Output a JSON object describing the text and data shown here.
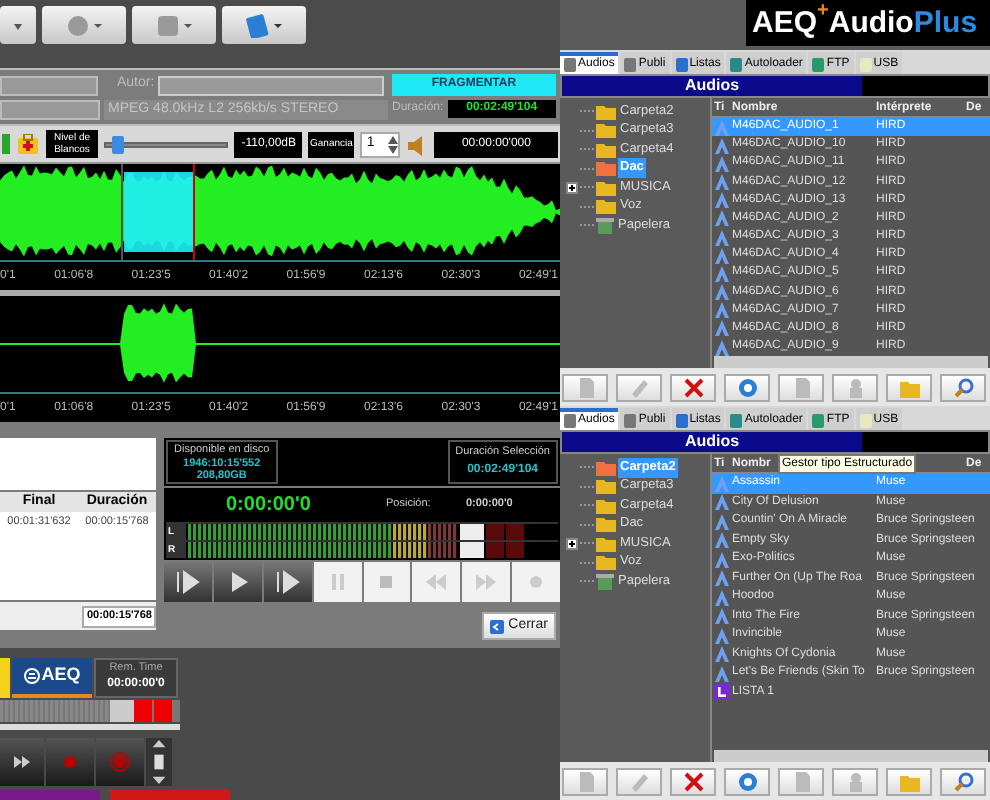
{
  "editor": {
    "author_label": "Autor:",
    "fragment_button": "FRAGMENTAR",
    "format": "MPEG  48.0kHz L2 256kb/s STEREO",
    "duration_label": "Duración:",
    "duration": "00:02:49'104",
    "blank_level_label": "Nivel de Blancos",
    "blank_slider": {
      "level": 0.06
    },
    "blank_db": "-110,00dB",
    "gain_label": "Ganancia",
    "gain": "1",
    "position": "00:00:00'000",
    "timeline_top": [
      "0'1",
      "01:06'8",
      "01:23'5",
      "01:40'2",
      "01:56'9",
      "02:13'6",
      "02:30'3",
      "02:49'1"
    ],
    "timeline_bottom": [
      "0'1",
      "01:06'8",
      "01:23'5",
      "01:40'2",
      "01:56'9",
      "02:13'6",
      "02:30'3",
      "02:49'1"
    ]
  },
  "segments": {
    "columns": [
      "Final",
      "Duración"
    ],
    "rows": [
      [
        "00:01:31'632",
        "00:00:15'768"
      ]
    ],
    "total": "00:00:15'768"
  },
  "player": {
    "disk_label": "Disponible en disco",
    "disk_time": "1946:10:15'552",
    "disk_size": "208,80GB",
    "selection_label": "Duración Selección",
    "selection_duration": "00:02:49'104",
    "time": "0:00:00'0",
    "position_label": "Posición:",
    "position": "0:00:00'0",
    "meters": [
      {
        "label": "L"
      },
      {
        "label": "R"
      }
    ],
    "close_button": "Cerrar"
  },
  "recorder": {
    "logo": "AEQ",
    "rem_time_label": "Rem. Time",
    "rem_time": "00:00:00'0"
  },
  "brand": {
    "prefix": "AEQ",
    "sup": "+",
    "name": "Audio",
    "accent": "Plus"
  },
  "browsers": [
    {
      "tabs": [
        {
          "label": "Audios",
          "selected": true
        },
        {
          "label": "Publi",
          "selected": false
        },
        {
          "label": "Listas",
          "selected": false
        },
        {
          "label": "Autoloader",
          "selected": false
        },
        {
          "label": "FTP",
          "selected": false
        },
        {
          "label": "USB",
          "selected": false
        }
      ],
      "header": "Audios",
      "tree": [
        {
          "kind": "folder",
          "label": "Carpeta2",
          "selected": false
        },
        {
          "kind": "folder",
          "label": "Carpeta3",
          "selected": false
        },
        {
          "kind": "folder",
          "label": "Carpeta4",
          "selected": false
        },
        {
          "kind": "folder",
          "label": "Dac",
          "selected": true
        },
        {
          "kind": "folder",
          "label": "MUSICA",
          "selected": false,
          "expanded": false
        },
        {
          "kind": "folder",
          "label": "Voz",
          "selected": false
        },
        {
          "kind": "trash",
          "label": "Papelera",
          "selected": false
        }
      ],
      "columns": [
        "Ti",
        "Nombre",
        "Intérprete",
        "De"
      ],
      "rows": [
        {
          "kind": "audio",
          "name": "M46DAC_AUDIO_1",
          "artist": "HIRD",
          "selected": true
        },
        {
          "kind": "audio",
          "name": "M46DAC_AUDIO_10",
          "artist": "HIRD",
          "selected": false
        },
        {
          "kind": "audio",
          "name": "M46DAC_AUDIO_11",
          "artist": "HIRD",
          "selected": false
        },
        {
          "kind": "audio",
          "name": "M46DAC_AUDIO_12",
          "artist": "HIRD",
          "selected": false
        },
        {
          "kind": "audio",
          "name": "M46DAC_AUDIO_13",
          "artist": "HIRD",
          "selected": false
        },
        {
          "kind": "audio",
          "name": "M46DAC_AUDIO_2",
          "artist": "HIRD",
          "selected": false
        },
        {
          "kind": "audio",
          "name": "M46DAC_AUDIO_3",
          "artist": "HIRD",
          "selected": false
        },
        {
          "kind": "audio",
          "name": "M46DAC_AUDIO_4",
          "artist": "HIRD",
          "selected": false
        },
        {
          "kind": "audio",
          "name": "M46DAC_AUDIO_5",
          "artist": "HIRD",
          "selected": false
        },
        {
          "kind": "audio",
          "name": "M46DAC_AUDIO_6",
          "artist": "HIRD",
          "selected": false
        },
        {
          "kind": "audio",
          "name": "M46DAC_AUDIO_7",
          "artist": "HIRD",
          "selected": false
        },
        {
          "kind": "audio",
          "name": "M46DAC_AUDIO_8",
          "artist": "HIRD",
          "selected": false
        },
        {
          "kind": "audio",
          "name": "M46DAC_AUDIO_9",
          "artist": "HIRD",
          "selected": false
        }
      ]
    },
    {
      "tabs": [
        {
          "label": "Audios",
          "selected": true
        },
        {
          "label": "Publi",
          "selected": false
        },
        {
          "label": "Listas",
          "selected": false
        },
        {
          "label": "Autoloader",
          "selected": false
        },
        {
          "label": "FTP",
          "selected": false
        },
        {
          "label": "USB",
          "selected": false
        }
      ],
      "header": "Audios",
      "tooltip": "Gestor tipo Estructurado",
      "tree": [
        {
          "kind": "folder",
          "label": "Carpeta2",
          "selected": true
        },
        {
          "kind": "folder",
          "label": "Carpeta3",
          "selected": false
        },
        {
          "kind": "folder",
          "label": "Carpeta4",
          "selected": false
        },
        {
          "kind": "folder",
          "label": "Dac",
          "selected": false
        },
        {
          "kind": "folder",
          "label": "MUSICA",
          "selected": false,
          "expanded": false
        },
        {
          "kind": "folder",
          "label": "Voz",
          "selected": false
        },
        {
          "kind": "trash",
          "label": "Papelera",
          "selected": false
        }
      ],
      "columns": [
        "Ti",
        "Nombr",
        "",
        "De"
      ],
      "rows": [
        {
          "kind": "audio",
          "name": "Assassin",
          "artist": "Muse",
          "selected": true
        },
        {
          "kind": "audio",
          "name": "City Of Delusion",
          "artist": "Muse",
          "selected": false
        },
        {
          "kind": "audio",
          "name": "Countin' On A Miracle",
          "artist": "Bruce Springsteen",
          "selected": false
        },
        {
          "kind": "audio",
          "name": "Empty Sky",
          "artist": "Bruce Springsteen",
          "selected": false
        },
        {
          "kind": "audio",
          "name": "Exo-Politics",
          "artist": "Muse",
          "selected": false
        },
        {
          "kind": "audio",
          "name": "Further On (Up The Roa",
          "artist": "Bruce Springsteen",
          "selected": false
        },
        {
          "kind": "audio",
          "name": "Hoodoo",
          "artist": "Muse",
          "selected": false
        },
        {
          "kind": "audio",
          "name": "Into The Fire",
          "artist": "Bruce Springsteen",
          "selected": false
        },
        {
          "kind": "audio",
          "name": "Invincible",
          "artist": "Muse",
          "selected": false
        },
        {
          "kind": "audio",
          "name": "Knights Of Cydonia",
          "artist": "Muse",
          "selected": false
        },
        {
          "kind": "audio",
          "name": "Let's Be Friends (Skin To",
          "artist": "Bruce Springsteen",
          "selected": false
        },
        {
          "kind": "list",
          "name": "LISTA 1",
          "artist": "",
          "selected": false
        }
      ]
    }
  ]
}
